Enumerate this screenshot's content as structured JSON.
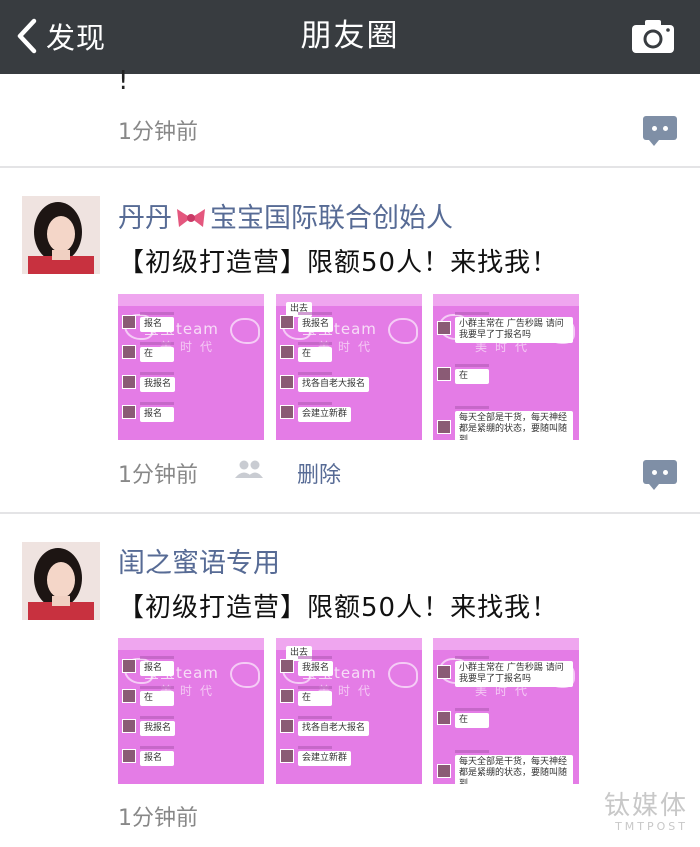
{
  "navbar": {
    "back_label": "发现",
    "title": "朋友圈"
  },
  "prev_post": {
    "text_tail": "!",
    "time": "1分钟前"
  },
  "posts": [
    {
      "name_part1": "丹丹",
      "name_part2": "宝宝国际联合创始人",
      "text": "【初级打造营】限额50人！来找我！",
      "time": "1分钟前",
      "delete_label": "删除",
      "images": [
        {
          "header": "",
          "watermark": "宝宝team",
          "watermark2": "美时代",
          "messages": [
            "报名",
            "在",
            "我报名",
            "报名"
          ]
        },
        {
          "header": "出去",
          "watermark": "宝宝team",
          "watermark2": "美时代",
          "messages": [
            "我报名",
            "在",
            "找各自老大报名",
            "会建立新群"
          ]
        },
        {
          "header": "",
          "watermark": "",
          "watermark2": "美时代",
          "messages": [
            "小群主常在 广告秒踢 请问我要早了丁报名吗",
            "在",
            "每天全部是干货，每天神经都是紧绷的状态，要随叫随到"
          ]
        }
      ]
    },
    {
      "name": "闺之蜜语专用",
      "text": "【初级打造营】限额50人！来找我！",
      "time": "1分钟前",
      "images": [
        {
          "header": "",
          "watermark": "宝宝team",
          "watermark2": "美时代",
          "messages": [
            "报名",
            "在",
            "我报名",
            "报名"
          ]
        },
        {
          "header": "出去",
          "watermark": "宝宝team",
          "watermark2": "美时代",
          "messages": [
            "我报名",
            "在",
            "找各自老大报名",
            "会建立新群"
          ]
        },
        {
          "header": "",
          "watermark": "",
          "watermark2": "美时代",
          "messages": [
            "小群主常在 广告秒踢 请问我要早了丁报名吗",
            "在",
            "每天全部是干货，每天神经都是紧绷的状态，要随叫随到"
          ]
        }
      ]
    }
  ],
  "watermark": {
    "cn": "钛媒体",
    "en": "TMTPOST"
  },
  "colors": {
    "navbar": "#383c40",
    "link": "#576b95",
    "thumbnail_pink": "#e47ce6"
  }
}
